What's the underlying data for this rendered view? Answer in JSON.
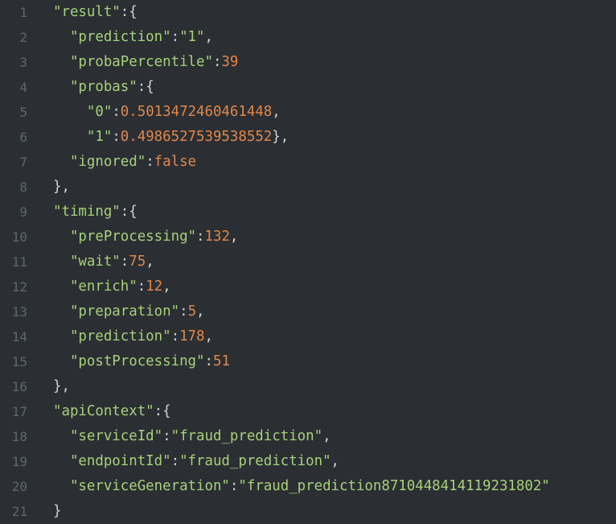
{
  "colors": {
    "background": "#2b2f33",
    "line_number": "#5e6670",
    "key_string": "#a7d07a",
    "number_literal": "#e0874c",
    "punctuation": "#cfd3d7"
  },
  "lines": [
    {
      "num": "1",
      "indent": "",
      "tokens": [
        {
          "t": "key",
          "v": "\"result\""
        },
        {
          "t": "punc",
          "v": ":{"
        }
      ]
    },
    {
      "num": "2",
      "indent": "  ",
      "tokens": [
        {
          "t": "key",
          "v": "\"prediction\""
        },
        {
          "t": "punc",
          "v": ":"
        },
        {
          "t": "str",
          "v": "\"1\""
        },
        {
          "t": "punc",
          "v": ","
        }
      ]
    },
    {
      "num": "3",
      "indent": "  ",
      "tokens": [
        {
          "t": "key",
          "v": "\"probaPercentile\""
        },
        {
          "t": "punc",
          "v": ":"
        },
        {
          "t": "num",
          "v": "39"
        }
      ]
    },
    {
      "num": "4",
      "indent": "  ",
      "tokens": [
        {
          "t": "key",
          "v": "\"probas\""
        },
        {
          "t": "punc",
          "v": ":{"
        }
      ]
    },
    {
      "num": "5",
      "indent": "    ",
      "tokens": [
        {
          "t": "key",
          "v": "\"0\""
        },
        {
          "t": "punc",
          "v": ":"
        },
        {
          "t": "num",
          "v": "0.5013472460461448"
        },
        {
          "t": "punc",
          "v": ","
        }
      ]
    },
    {
      "num": "6",
      "indent": "    ",
      "tokens": [
        {
          "t": "key",
          "v": "\"1\""
        },
        {
          "t": "punc",
          "v": ":"
        },
        {
          "t": "num",
          "v": "0.4986527539538552"
        },
        {
          "t": "punc",
          "v": "},"
        }
      ]
    },
    {
      "num": "7",
      "indent": "  ",
      "tokens": [
        {
          "t": "key",
          "v": "\"ignored\""
        },
        {
          "t": "punc",
          "v": ":"
        },
        {
          "t": "kw",
          "v": "false"
        }
      ]
    },
    {
      "num": "8",
      "indent": "",
      "tokens": [
        {
          "t": "punc",
          "v": "},"
        }
      ]
    },
    {
      "num": "9",
      "indent": "",
      "tokens": [
        {
          "t": "key",
          "v": "\"timing\""
        },
        {
          "t": "punc",
          "v": ":{"
        }
      ]
    },
    {
      "num": "10",
      "indent": "  ",
      "tokens": [
        {
          "t": "key",
          "v": "\"preProcessing\""
        },
        {
          "t": "punc",
          "v": ":"
        },
        {
          "t": "num",
          "v": "132"
        },
        {
          "t": "punc",
          "v": ","
        }
      ]
    },
    {
      "num": "11",
      "indent": "  ",
      "tokens": [
        {
          "t": "key",
          "v": "\"wait\""
        },
        {
          "t": "punc",
          "v": ":"
        },
        {
          "t": "num",
          "v": "75"
        },
        {
          "t": "punc",
          "v": ","
        }
      ]
    },
    {
      "num": "12",
      "indent": "  ",
      "tokens": [
        {
          "t": "key",
          "v": "\"enrich\""
        },
        {
          "t": "punc",
          "v": ":"
        },
        {
          "t": "num",
          "v": "12"
        },
        {
          "t": "punc",
          "v": ","
        }
      ]
    },
    {
      "num": "13",
      "indent": "  ",
      "tokens": [
        {
          "t": "key",
          "v": "\"preparation\""
        },
        {
          "t": "punc",
          "v": ":"
        },
        {
          "t": "num",
          "v": "5"
        },
        {
          "t": "punc",
          "v": ","
        }
      ]
    },
    {
      "num": "14",
      "indent": "  ",
      "tokens": [
        {
          "t": "key",
          "v": "\"prediction\""
        },
        {
          "t": "punc",
          "v": ":"
        },
        {
          "t": "num",
          "v": "178"
        },
        {
          "t": "punc",
          "v": ","
        }
      ]
    },
    {
      "num": "15",
      "indent": "  ",
      "tokens": [
        {
          "t": "key",
          "v": "\"postProcessing\""
        },
        {
          "t": "punc",
          "v": ":"
        },
        {
          "t": "num",
          "v": "51"
        }
      ]
    },
    {
      "num": "16",
      "indent": "",
      "tokens": [
        {
          "t": "punc",
          "v": "},"
        }
      ]
    },
    {
      "num": "17",
      "indent": "",
      "tokens": [
        {
          "t": "key",
          "v": "\"apiContext\""
        },
        {
          "t": "punc",
          "v": ":{"
        }
      ]
    },
    {
      "num": "18",
      "indent": "  ",
      "tokens": [
        {
          "t": "key",
          "v": "\"serviceId\""
        },
        {
          "t": "punc",
          "v": ":"
        },
        {
          "t": "str",
          "v": "\"fraud_prediction\""
        },
        {
          "t": "punc",
          "v": ","
        }
      ]
    },
    {
      "num": "19",
      "indent": "  ",
      "tokens": [
        {
          "t": "key",
          "v": "\"endpointId\""
        },
        {
          "t": "punc",
          "v": ":"
        },
        {
          "t": "str",
          "v": "\"fraud_prediction\""
        },
        {
          "t": "punc",
          "v": ","
        }
      ]
    },
    {
      "num": "20",
      "indent": "  ",
      "tokens": [
        {
          "t": "key",
          "v": "\"serviceGeneration\""
        },
        {
          "t": "punc",
          "v": ":"
        },
        {
          "t": "str",
          "v": "\"fraud_prediction8710448414119231802\""
        }
      ]
    },
    {
      "num": "21",
      "indent": "",
      "tokens": [
        {
          "t": "punc",
          "v": "}"
        }
      ]
    }
  ]
}
